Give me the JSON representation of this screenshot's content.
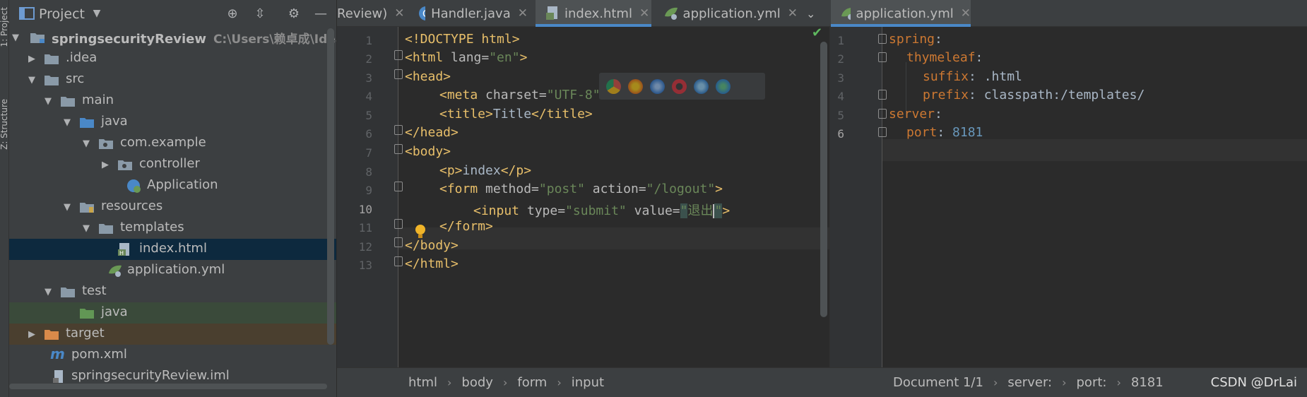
{
  "left_stripe": {
    "project_tab": "1: Project",
    "structure_tab": "Z: Structure"
  },
  "project_panel": {
    "title": "Project",
    "tree": [
      {
        "label": "springsecurityReview",
        "path": "C:\\Users\\赖卓成\\IdeaPro",
        "type": "module"
      },
      {
        "label": ".idea",
        "type": "folder"
      },
      {
        "label": "src",
        "type": "folder"
      },
      {
        "label": "main",
        "type": "folder"
      },
      {
        "label": "java",
        "type": "source-folder"
      },
      {
        "label": "com.example",
        "type": "package"
      },
      {
        "label": "controller",
        "type": "package"
      },
      {
        "label": "Application",
        "type": "spring-class"
      },
      {
        "label": "resources",
        "type": "resource-folder"
      },
      {
        "label": "templates",
        "type": "folder"
      },
      {
        "label": "index.html",
        "type": "html-file"
      },
      {
        "label": "application.yml",
        "type": "yml-file"
      },
      {
        "label": "test",
        "type": "folder"
      },
      {
        "label": "java",
        "type": "test-folder"
      },
      {
        "label": "target",
        "type": "excluded-folder"
      },
      {
        "label": "pom.xml",
        "type": "maven-file"
      },
      {
        "label": "springsecurityReview.iml",
        "type": "iml-file"
      }
    ]
  },
  "tabs": [
    {
      "label": "Review)"
    },
    {
      "label": "Handler.java"
    },
    {
      "label": "index.html"
    },
    {
      "label": "application.yml"
    },
    {
      "label": "application.yml"
    }
  ],
  "editor_left": {
    "line_numbers": [
      "1",
      "2",
      "3",
      "4",
      "5",
      "6",
      "7",
      "8",
      "9",
      "10",
      "11",
      "12",
      "13"
    ],
    "lines": {
      "l1": "<!DOCTYPE html>",
      "l2a": "<html",
      "l2b": " lang=",
      "l2c": "\"en\"",
      "l2d": ">",
      "l3": "<head>",
      "l4a": "<meta",
      "l4b": " charset=",
      "l4c": "\"UTF-8\"",
      "l4d": ">",
      "l5": "<title>",
      "l5b": "Title",
      "l5c": "</title>",
      "l6": "</head>",
      "l7": "<body>",
      "l8a": "<p>",
      "l8b": "index",
      "l8c": "</p>",
      "l9a": "<form",
      "l9b": " method=",
      "l9c": "\"post\"",
      "l9d": " action=",
      "l9e": "\"/logout\"",
      "l9f": ">",
      "l10a": "<input",
      "l10b": " type=",
      "l10c": "\"submit\"",
      "l10d": " value=",
      "l10e": "\"",
      "l10f": "退出",
      "l10g": "\"",
      "l10h": ">",
      "l11": "</form>",
      "l12": "</body>",
      "l13": "</html>"
    }
  },
  "editor_right": {
    "line_numbers": [
      "1",
      "2",
      "3",
      "4",
      "5",
      "6"
    ],
    "lines": {
      "r1k": "spring",
      "r1c": ":",
      "r2k": "thymeleaf",
      "r2c": ":",
      "r3k": "suffix",
      "r3v": ": .html",
      "r4k": "prefix",
      "r4v": ": classpath:/templates/",
      "r5k": "server",
      "r5c": ":",
      "r6k": "port",
      "r6c": ": ",
      "r6v": "8181"
    }
  },
  "breadcrumbs_left": [
    "html",
    "body",
    "form",
    "input"
  ],
  "breadcrumbs_right": [
    "Document 1/1",
    "server:",
    "port:",
    "8181"
  ],
  "watermark": "CSDN @DrLai",
  "colors": {
    "tag": "#e8bf6a",
    "string": "#6a8759",
    "yaml_key": "#cc7832",
    "number": "#6897bb",
    "selection": "#0d293e",
    "active_tab": "#4a88c7"
  }
}
